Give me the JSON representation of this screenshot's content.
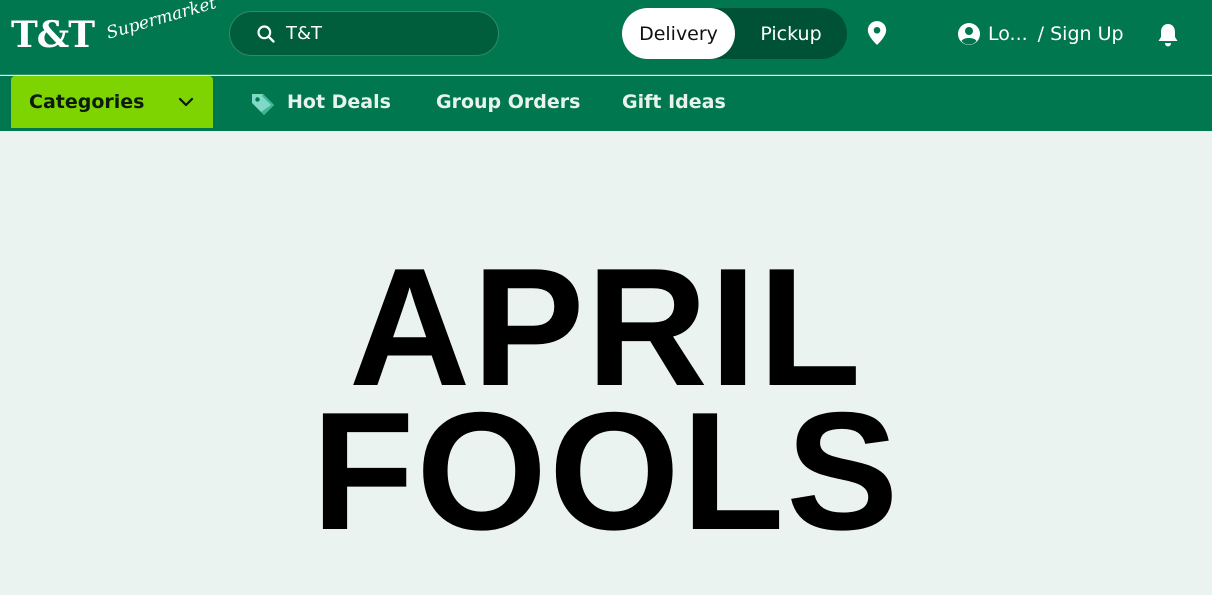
{
  "header": {
    "logo_main": "T&T",
    "logo_sub": "Supermarket",
    "search": {
      "value": "T&T"
    },
    "mode_toggle": {
      "delivery": "Delivery",
      "pickup": "Pickup",
      "active": "delivery"
    },
    "account": {
      "login": "Lo...",
      "signup": "/ Sign Up"
    }
  },
  "nav": {
    "categories": "Categories",
    "items": [
      "Hot Deals",
      "Group Orders",
      "Gift Ideas"
    ]
  },
  "hero": {
    "line1": "APRIL",
    "line2": "FOOLS"
  },
  "colors": {
    "brand_green": "#00774e",
    "dark_green": "#005e3d",
    "category_green": "#7dd400",
    "hero_bg": "#eaf3f0"
  },
  "icons": [
    "search-icon",
    "location-pin-icon",
    "user-circle-icon",
    "bell-icon",
    "chevron-down-icon",
    "price-tag-icon"
  ]
}
